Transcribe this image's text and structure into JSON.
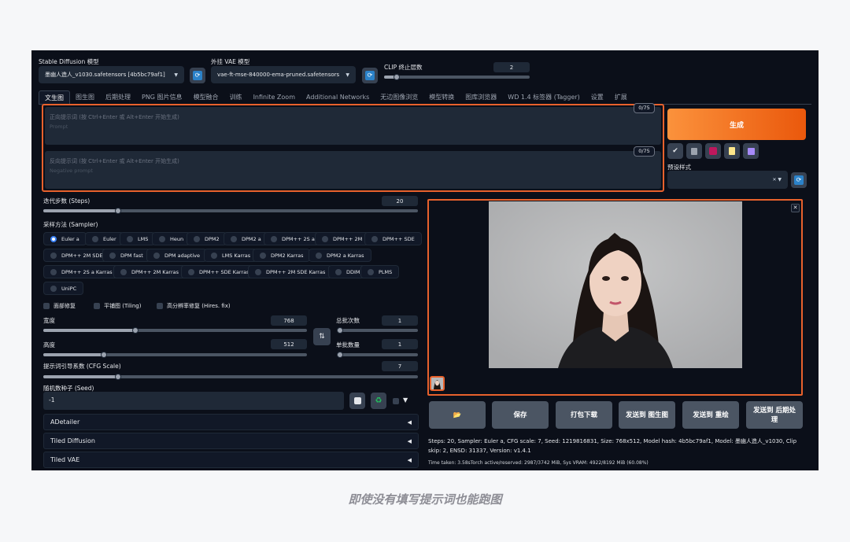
{
  "model": {
    "sd_label": "Stable Diffusion 模型",
    "sd_value": "墨幽人造人_v1030.safetensors [4b5bc79af1]",
    "vae_label": "外挂 VAE 模型",
    "vae_value": "vae-ft-mse-840000-ema-pruned.safetensors",
    "clip_label": "CLIP 终止层数",
    "clip_value": "2"
  },
  "tabs": [
    "文生图",
    "图生图",
    "后期处理",
    "PNG 图片信息",
    "模型融合",
    "训练",
    "Infinite Zoom",
    "Additional Networks",
    "无边图像浏览",
    "模型转换",
    "图库浏览器",
    "WD 1.4 标签器 (Tagger)",
    "设置",
    "扩展"
  ],
  "prompt": {
    "placeholder": "正向提示词 (按 Ctrl+Enter 或 Alt+Enter 开始生成)",
    "hint": "Prompt",
    "counter": "0/75"
  },
  "negative": {
    "placeholder": "反向提示词 (按 Ctrl+Enter 或 Alt+Enter 开始生成)",
    "hint": "Negative prompt",
    "counter": "0/75"
  },
  "generate_label": "生成",
  "styles_label": "预设样式",
  "steps": {
    "label": "迭代步数 (Steps)",
    "value": "20",
    "fraction": 0.2
  },
  "sampler": {
    "label": "采样方法 (Sampler)",
    "selected": "Euler a",
    "options": [
      "Euler a",
      "Euler",
      "LMS",
      "Heun",
      "DPM2",
      "DPM2 a",
      "DPM++ 2S a",
      "DPM++ 2M",
      "DPM++ SDE",
      "DPM++ 2M SDE",
      "DPM fast",
      "DPM adaptive",
      "LMS Karras",
      "DPM2 Karras",
      "DPM2 a Karras",
      "DPM++ 2S a Karras",
      "DPM++ 2M Karras",
      "DPM++ SDE Karras",
      "DPM++ 2M SDE Karras",
      "DDIM",
      "PLMS",
      "UniPC"
    ]
  },
  "checks": {
    "face": "面部修复",
    "tiling": "平铺图 (Tiling)",
    "hires": "高分辨率修复 (Hires. fix)"
  },
  "width": {
    "label": "宽度",
    "value": "768",
    "fraction": 0.35
  },
  "height": {
    "label": "高度",
    "value": "512",
    "fraction": 0.23
  },
  "batch_count": {
    "label": "总批次数",
    "value": "1",
    "fraction": 0.0
  },
  "batch_size": {
    "label": "单批数量",
    "value": "1",
    "fraction": 0.0
  },
  "cfg": {
    "label": "提示词引导系数 (CFG Scale)",
    "value": "7",
    "fraction": 0.2
  },
  "seed": {
    "label": "随机数种子 (Seed)",
    "value": "-1"
  },
  "accordions": [
    "ADetailer",
    "Tiled Diffusion",
    "Tiled VAE"
  ],
  "actions": [
    "📂",
    "保存",
    "打包下载",
    "发送到 图生图",
    "发送到 重绘",
    "发送到 后期处理"
  ],
  "info": "Steps: 20, Sampler: Euler a, CFG scale: 7, Seed: 1219816831, Size: 768x512, Model hash: 4b5bc79af1, Model: 墨幽人造人_v1030, Clip skip: 2, ENSD: 31337, Version: v1.4.1",
  "timing": "Time taken: 3.58sTorch active/reserved: 2987/3742 MiB, Sys VRAM: 4922/8192 MiB (60.08%)",
  "caption": "即使没有填写提示词也能跑图",
  "colors": {
    "accent": "#e8612c",
    "generate": "#f97316",
    "background": "#0b0f19"
  }
}
